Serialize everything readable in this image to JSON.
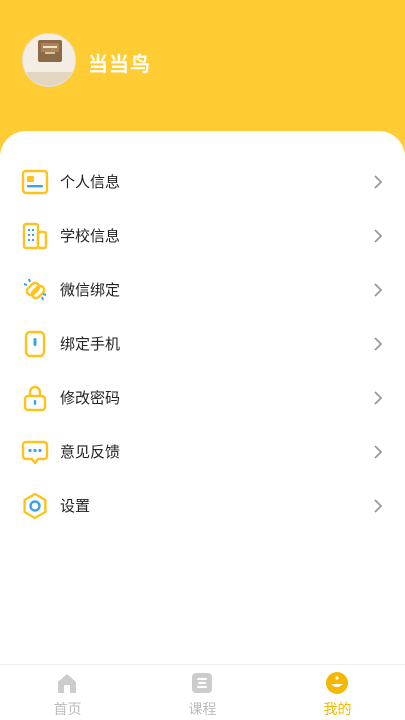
{
  "header": {
    "username": "当当鸟",
    "background_color": "#FFCC33",
    "avatar_icon": "user-avatar"
  },
  "menu": [
    {
      "label": "个人信息",
      "icon": "id-card-icon"
    },
    {
      "label": "学校信息",
      "icon": "building-icon"
    },
    {
      "label": "微信绑定",
      "icon": "link-icon"
    },
    {
      "label": "绑定手机",
      "icon": "phone-icon"
    },
    {
      "label": "修改密码",
      "icon": "lock-icon"
    },
    {
      "label": "意见反馈",
      "icon": "chat-bubble-icon"
    },
    {
      "label": "设置",
      "icon": "gear-icon"
    }
  ],
  "tabbar": {
    "tabs": [
      {
        "label": "首页",
        "icon": "home-icon",
        "active": false
      },
      {
        "label": "课程",
        "icon": "course-list-icon",
        "active": false
      },
      {
        "label": "我的",
        "icon": "profile-icon",
        "active": true
      }
    ],
    "active_color": "#F5B800",
    "inactive_color": "#BBBBBB"
  },
  "colors": {
    "icon_outline": "#FFC21A",
    "icon_accent": "#3AA0F0",
    "chevron": "#999999"
  }
}
